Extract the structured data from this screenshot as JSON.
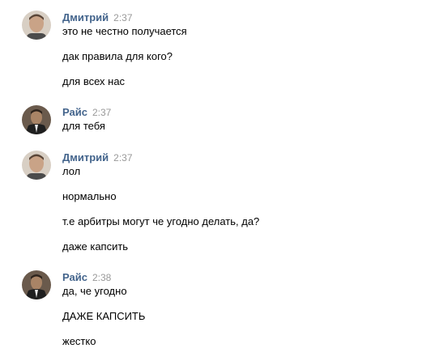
{
  "messages": [
    {
      "author": "Дмитрий",
      "time": "2:37",
      "avatar_icon": "user-photo-avatar",
      "lines": [
        "это не честно получается",
        "дак правила для кого?",
        "для всех нас"
      ]
    },
    {
      "author": "Райс",
      "time": "2:37",
      "avatar_icon": "user-photo-avatar",
      "lines": [
        "для тебя"
      ]
    },
    {
      "author": "Дмитрий",
      "time": "2:37",
      "avatar_icon": "user-photo-avatar",
      "lines": [
        "лол",
        "нормально",
        "т.е арбитры могут че угодно делать, да?",
        "даже капсить"
      ]
    },
    {
      "author": "Райс",
      "time": "2:38",
      "avatar_icon": "user-photo-avatar",
      "lines": [
        "да, че угодно",
        "ДАЖЕ КАПСИТЬ",
        "жестко"
      ]
    }
  ],
  "colors": {
    "author_name": "#43648c",
    "timestamp": "#999999",
    "message_text": "#000000",
    "background": "#ffffff"
  }
}
